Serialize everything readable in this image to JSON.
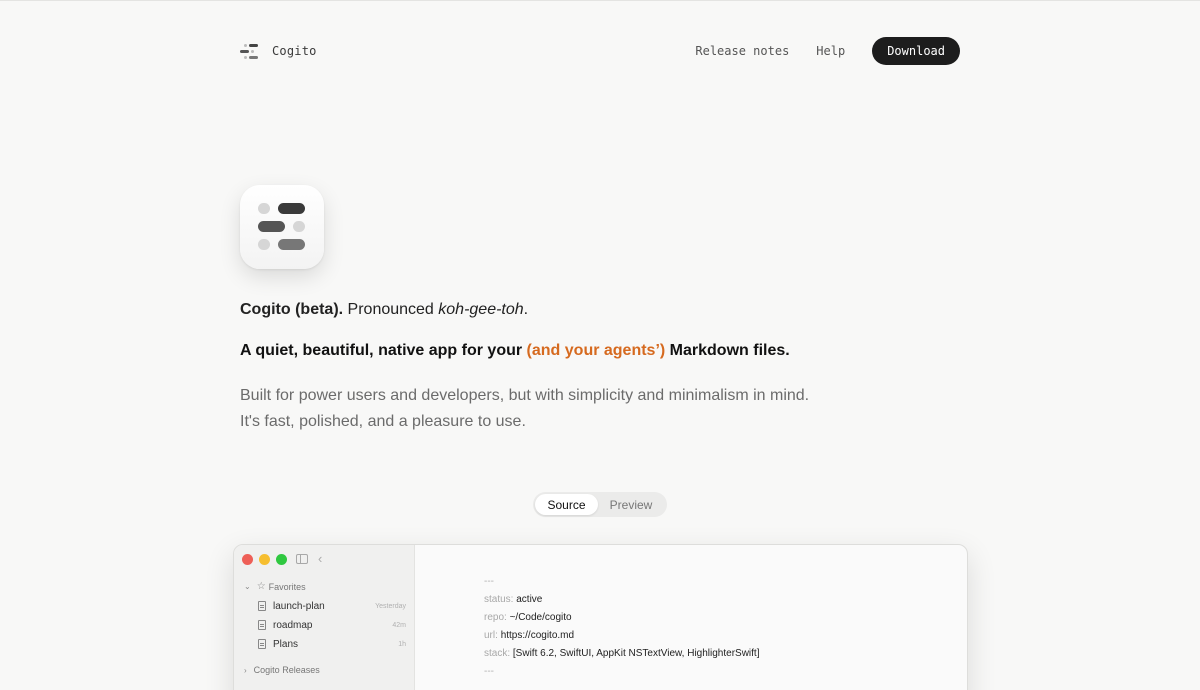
{
  "header": {
    "brand_name": "Cogito",
    "nav": [
      "Release notes",
      "Help"
    ],
    "download_label": "Download"
  },
  "hero": {
    "tagline_bold": "Cogito (beta).",
    "tagline_rest": " Pronounced ",
    "tagline_italic": "koh-gee-toh",
    "tagline_end": ".",
    "headline_start": "A quiet, beautiful, native app for your ",
    "headline_accent": "(and your agents’)",
    "headline_end": " Markdown files.",
    "desc_line1": "Built for power users and developers, but with simplicity and minimalism in mind.",
    "desc_line2": "It's fast, polished, and a pleasure to use."
  },
  "toggle": {
    "source": "Source",
    "preview": "Preview",
    "selected": "Source"
  },
  "window": {
    "sidebar": {
      "favorites_label": "Favorites",
      "files": [
        {
          "name": "launch-plan",
          "time": "Yesterday"
        },
        {
          "name": "roadmap",
          "time": "42m"
        },
        {
          "name": "Plans",
          "time": "1h"
        }
      ],
      "releases_label": "Cogito Releases"
    },
    "editor": {
      "delimiter": "---",
      "lines": [
        {
          "key": "status:",
          "value": "active"
        },
        {
          "key": "repo:",
          "value": "~/Code/cogito"
        },
        {
          "key": "url:",
          "value": "https://cogito.md"
        },
        {
          "key": "stack:",
          "value": "[Swift 6.2, SwiftUI, AppKit NSTextView, HighlighterSwift]"
        }
      ]
    }
  },
  "colors": {
    "accent": "#d66a1f",
    "traffic_red": "#ee5f57",
    "traffic_yellow": "#f6be2f",
    "traffic_green": "#2fc840"
  }
}
